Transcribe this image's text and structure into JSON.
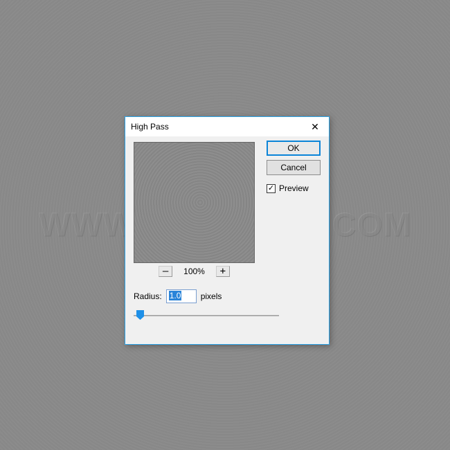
{
  "watermark": "WWW.PSD-DUDE.COM",
  "dialog": {
    "title": "High Pass",
    "closeGlyph": "✕",
    "ok": "OK",
    "cancel": "Cancel",
    "previewLabel": "Preview",
    "previewChecked": "✓",
    "zoom": {
      "minus": "–",
      "plus": "+",
      "level": "100%"
    },
    "radius": {
      "label": "Radius:",
      "value": "1.0",
      "unit": "pixels"
    }
  }
}
